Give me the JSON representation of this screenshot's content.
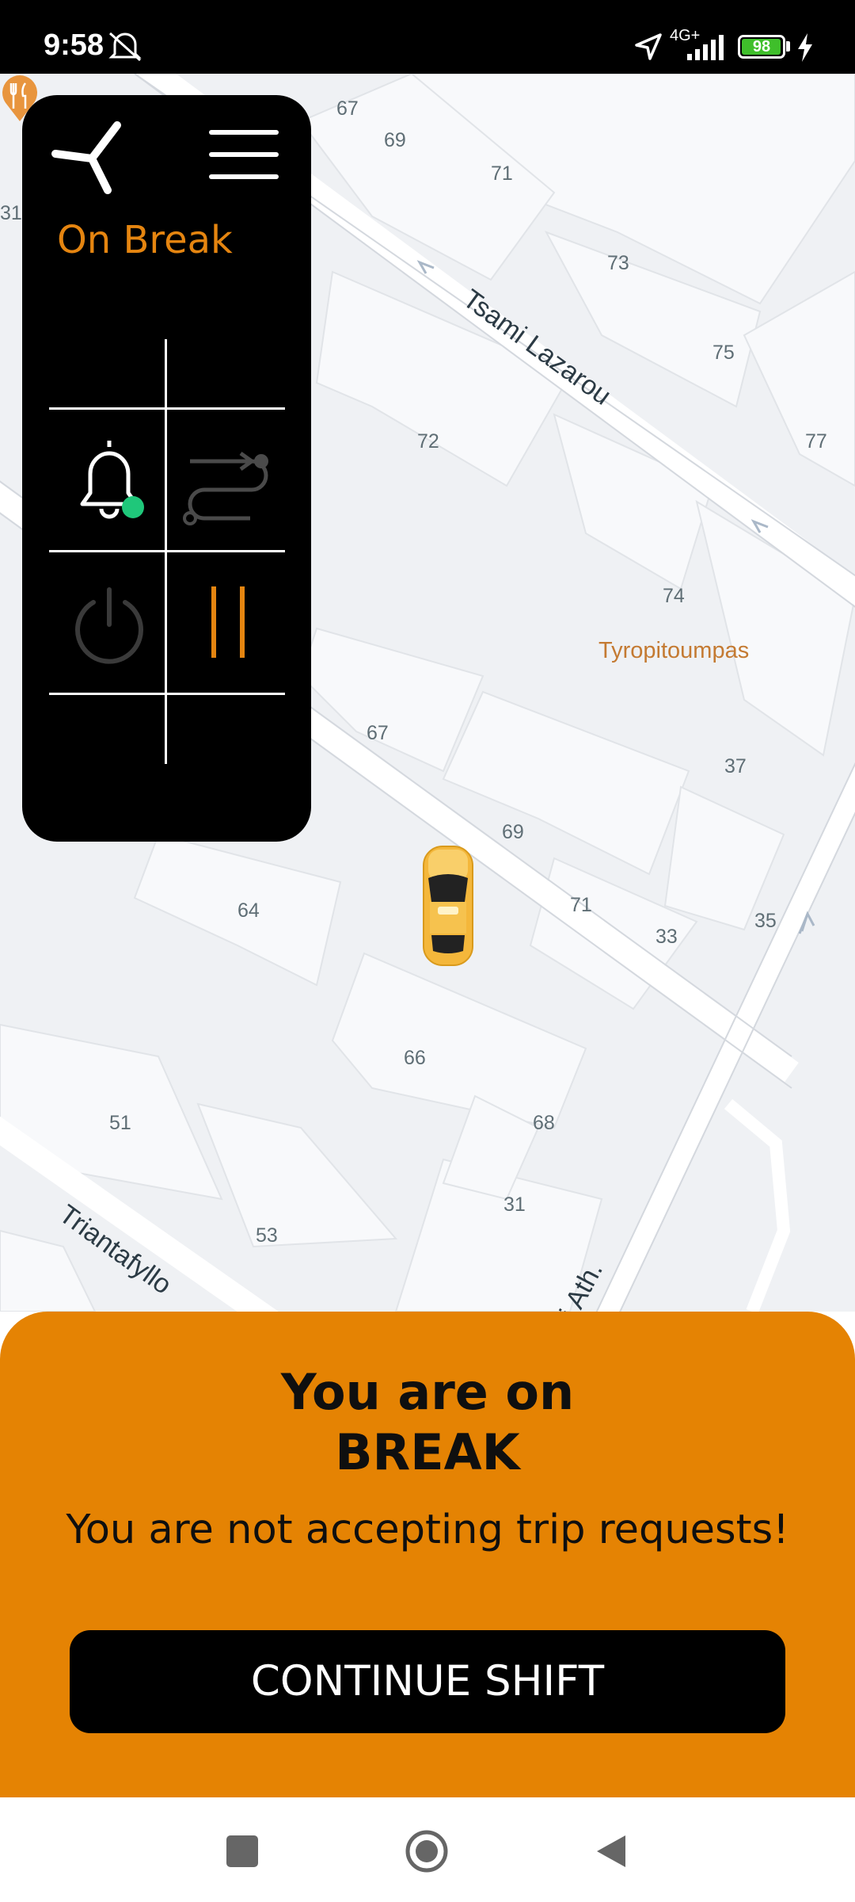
{
  "status_bar": {
    "time": "9:58",
    "network": "4G+",
    "battery": "98",
    "battery_level": 0.98,
    "icons": [
      "alarm-off-icon",
      "location-icon",
      "signal-icon",
      "battery-icon",
      "charging-icon"
    ]
  },
  "panel": {
    "status": "On Break",
    "status_color": "#e58510",
    "controls": [
      "bell-icon",
      "route-icon",
      "power-icon",
      "pause-icon"
    ],
    "notification_dot_color": "#1fc77a"
  },
  "map": {
    "streets": [
      "Tsami Lazarou",
      "Triantafyllo",
      "i Ath."
    ],
    "poi": "Tyropitoumpas",
    "house_numbers": [
      "67",
      "69",
      "71",
      "73",
      "75",
      "77",
      "31",
      "72",
      "74",
      "37",
      "67",
      "69",
      "71",
      "35",
      "33",
      "64",
      "66",
      "68",
      "51",
      "53",
      "31"
    ]
  },
  "sheet": {
    "title_line1": "You are on",
    "title_line2": "BREAK",
    "subtitle": "You are not accepting trip requests!",
    "button": "CONTINUE SHIFT",
    "background": "#e58303"
  },
  "nav": {
    "icons": [
      "recents-icon",
      "home-icon",
      "back-icon"
    ]
  }
}
